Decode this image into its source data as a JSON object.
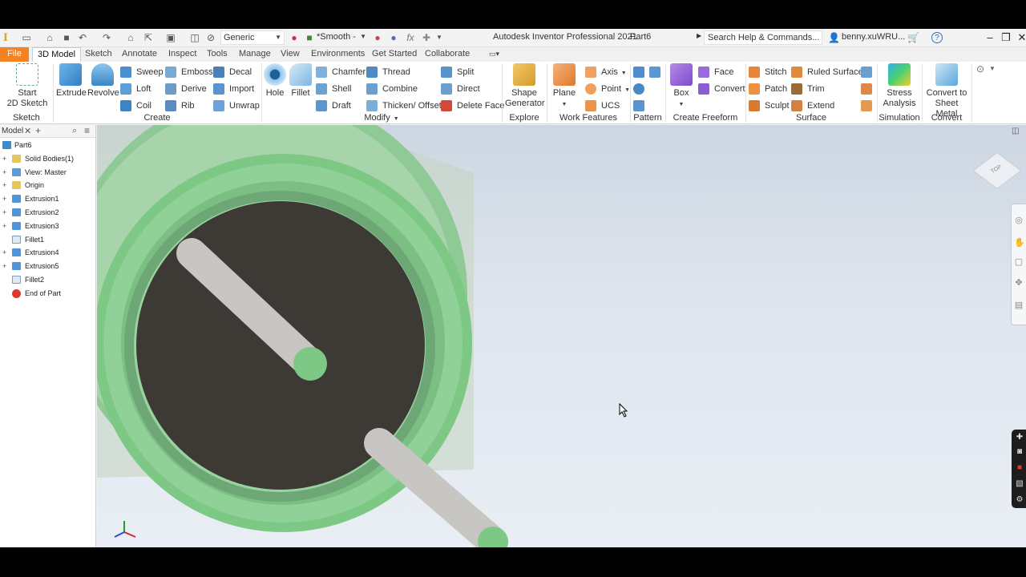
{
  "quick_access": {
    "appearance_select": "Generic",
    "visual_style_select": "*Smooth -",
    "fx_label": "fx"
  },
  "window": {
    "title": "Autodesk Inventor Professional 2021",
    "document": "Part6",
    "search_label": "Search Help & Commands...",
    "user": "benny.xuWRU...",
    "help_label": "?"
  },
  "tabs": [
    "File",
    "3D Model",
    "Sketch",
    "Annotate",
    "Inspect",
    "Tools",
    "Manage",
    "View",
    "Environments",
    "Get Started",
    "Collaborate"
  ],
  "ribbon": {
    "sketch": {
      "panel": "Sketch",
      "start_sketch_line1": "Start",
      "start_sketch_line2": "2D Sketch"
    },
    "create": {
      "panel": "Create",
      "extrude": "Extrude",
      "revolve": "Revolve",
      "sweep": "Sweep",
      "loft": "Loft",
      "coil": "Coil",
      "emboss": "Emboss",
      "derive": "Derive",
      "rib": "Rib",
      "decal": "Decal",
      "import": "Import",
      "unwrap": "Unwrap"
    },
    "modify": {
      "panel": "Modify",
      "hole": "Hole",
      "fillet": "Fillet",
      "chamfer": "Chamfer",
      "shell": "Shell",
      "draft": "Draft",
      "thread": "Thread",
      "combine": "Combine",
      "thicken": "Thicken/ Offset",
      "split": "Split",
      "direct": "Direct",
      "delete_face": "Delete Face"
    },
    "explore": {
      "panel": "Explore",
      "shape_gen_line1": "Shape",
      "shape_gen_line2": "Generator"
    },
    "work_features": {
      "panel": "Work Features",
      "plane": "Plane",
      "axis": "Axis",
      "point": "Point",
      "ucs": "UCS"
    },
    "pattern": {
      "panel": "Pattern"
    },
    "freeform": {
      "panel": "Create Freeform",
      "box": "Box",
      "face": "Face",
      "convert": "Convert"
    },
    "surface": {
      "panel": "Surface",
      "stitch": "Stitch",
      "patch": "Patch",
      "sculpt": "Sculpt",
      "ruled_surface": "Ruled Surface",
      "trim": "Trim",
      "extend": "Extend"
    },
    "simulation": {
      "panel": "Simulation",
      "stress_line1": "Stress",
      "stress_line2": "Analysis"
    },
    "convert": {
      "panel": "Convert",
      "sheet_line1": "Convert to",
      "sheet_line2": "Sheet Metal"
    }
  },
  "browser": {
    "tab_label": "Model",
    "items": [
      {
        "label": "Part6",
        "icon": "part-icon",
        "expand": ""
      },
      {
        "label": "Solid Bodies(1)",
        "icon": "folder-icon",
        "expand": "+"
      },
      {
        "label": "View: Master",
        "icon": "view-icon",
        "expand": "+"
      },
      {
        "label": "Origin",
        "icon": "folder-icon",
        "expand": "+"
      },
      {
        "label": "Extrusion1",
        "icon": "extrusion-icon",
        "expand": "+"
      },
      {
        "label": "Extrusion2",
        "icon": "extrusion-icon",
        "expand": "+"
      },
      {
        "label": "Extrusion3",
        "icon": "extrusion-icon",
        "expand": "+"
      },
      {
        "label": "Fillet1",
        "icon": "fillet-icon",
        "expand": ""
      },
      {
        "label": "Extrusion4",
        "icon": "extrusion-icon",
        "expand": "+"
      },
      {
        "label": "Extrusion5",
        "icon": "extrusion-icon",
        "expand": "+"
      },
      {
        "label": "Fillet2",
        "icon": "fillet-icon",
        "expand": ""
      },
      {
        "label": "End of Part",
        "icon": "end-of-part-icon",
        "expand": ""
      }
    ]
  },
  "viewport": {
    "viewcube_label": "TOP"
  },
  "colors": {
    "accent_file": "#f58220",
    "model_green": "#7fcb87",
    "model_dark": "#3d3a36",
    "rod_gray": "#c8c6c2"
  }
}
